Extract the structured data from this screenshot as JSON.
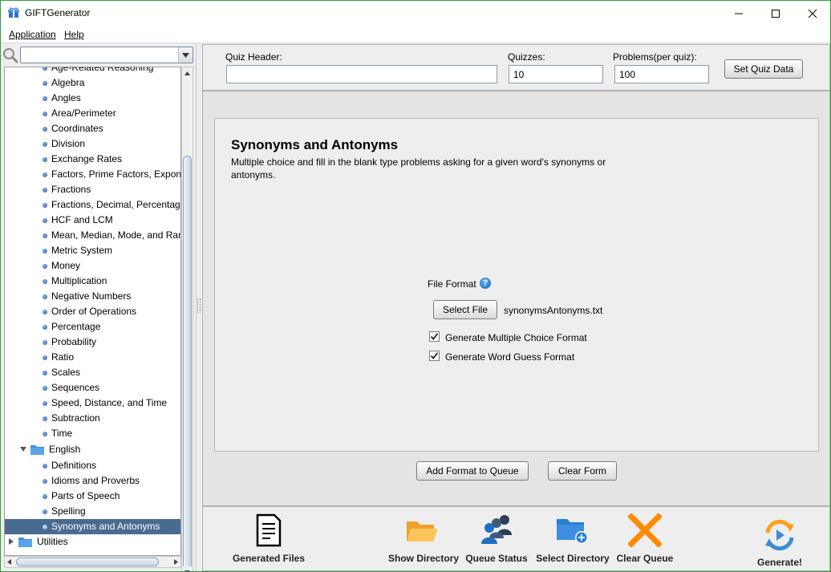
{
  "window": {
    "title": "GIFTGenerator",
    "controls": {
      "minimize": "minimize",
      "maximize": "maximize",
      "close": "close"
    }
  },
  "menu": {
    "application": "Application",
    "help": "Help"
  },
  "sidebar": {
    "search_value": "",
    "math_items": [
      "Age-Related Reasoning",
      "Algebra",
      "Angles",
      "Area/Perimeter",
      "Coordinates",
      "Division",
      "Exchange Rates",
      "Factors, Prime Factors, Expon",
      "Fractions",
      "Fractions, Decimal, Percentag",
      "HCF and LCM",
      "Mean, Median, Mode, and Ran",
      "Metric System",
      "Money",
      "Multiplication",
      "Negative Numbers",
      "Order of Operations",
      "Percentage",
      "Probability",
      "Ratio",
      "Scales",
      "Sequences",
      "Speed, Distance, and Time",
      "Subtraction",
      "Time"
    ],
    "english_folder": "English",
    "english_items": [
      "Definitions",
      "Idioms and Proverbs",
      "Parts of Speech",
      "Spelling",
      "Synonyms and Antonyms"
    ],
    "selected_item": "Synonyms and Antonyms",
    "utilities_folder": "Utilities"
  },
  "quiz_settings": {
    "header_label": "Quiz Header:",
    "header_value": "",
    "quizzes_label": "Quizzes:",
    "quizzes_value": "10",
    "problems_label": "Problems(per quiz):",
    "problems_value": "100",
    "set_button": "Set Quiz Data"
  },
  "generator": {
    "title": "Synonyms and Antonyms",
    "description": "Multiple choice and fill in the blank type problems asking for a given word's synonyms or antonyms.",
    "file_format_label": "File Format",
    "help_glyph": "?",
    "select_file_button": "Select File",
    "selected_file": "synonymsAntonyms.txt",
    "option_multiple_choice": "Generate Multiple Choice Format",
    "option_multiple_choice_checked": true,
    "option_word_guess": "Generate Word Guess Format",
    "option_word_guess_checked": true,
    "add_to_queue_button": "Add Format to Queue",
    "clear_form_button": "Clear Form"
  },
  "toolbar": {
    "generated_files": "Generated Files",
    "show_directory": "Show Directory",
    "queue_status": "Queue Status",
    "select_directory": "Select Directory",
    "clear_queue": "Clear Queue",
    "generate": "Generate!"
  },
  "colors": {
    "selection": "#496b8f",
    "folder_blue": "#3d8ee0",
    "clear_orange": "#ff8a00",
    "window_border": "#2f9d3c"
  }
}
